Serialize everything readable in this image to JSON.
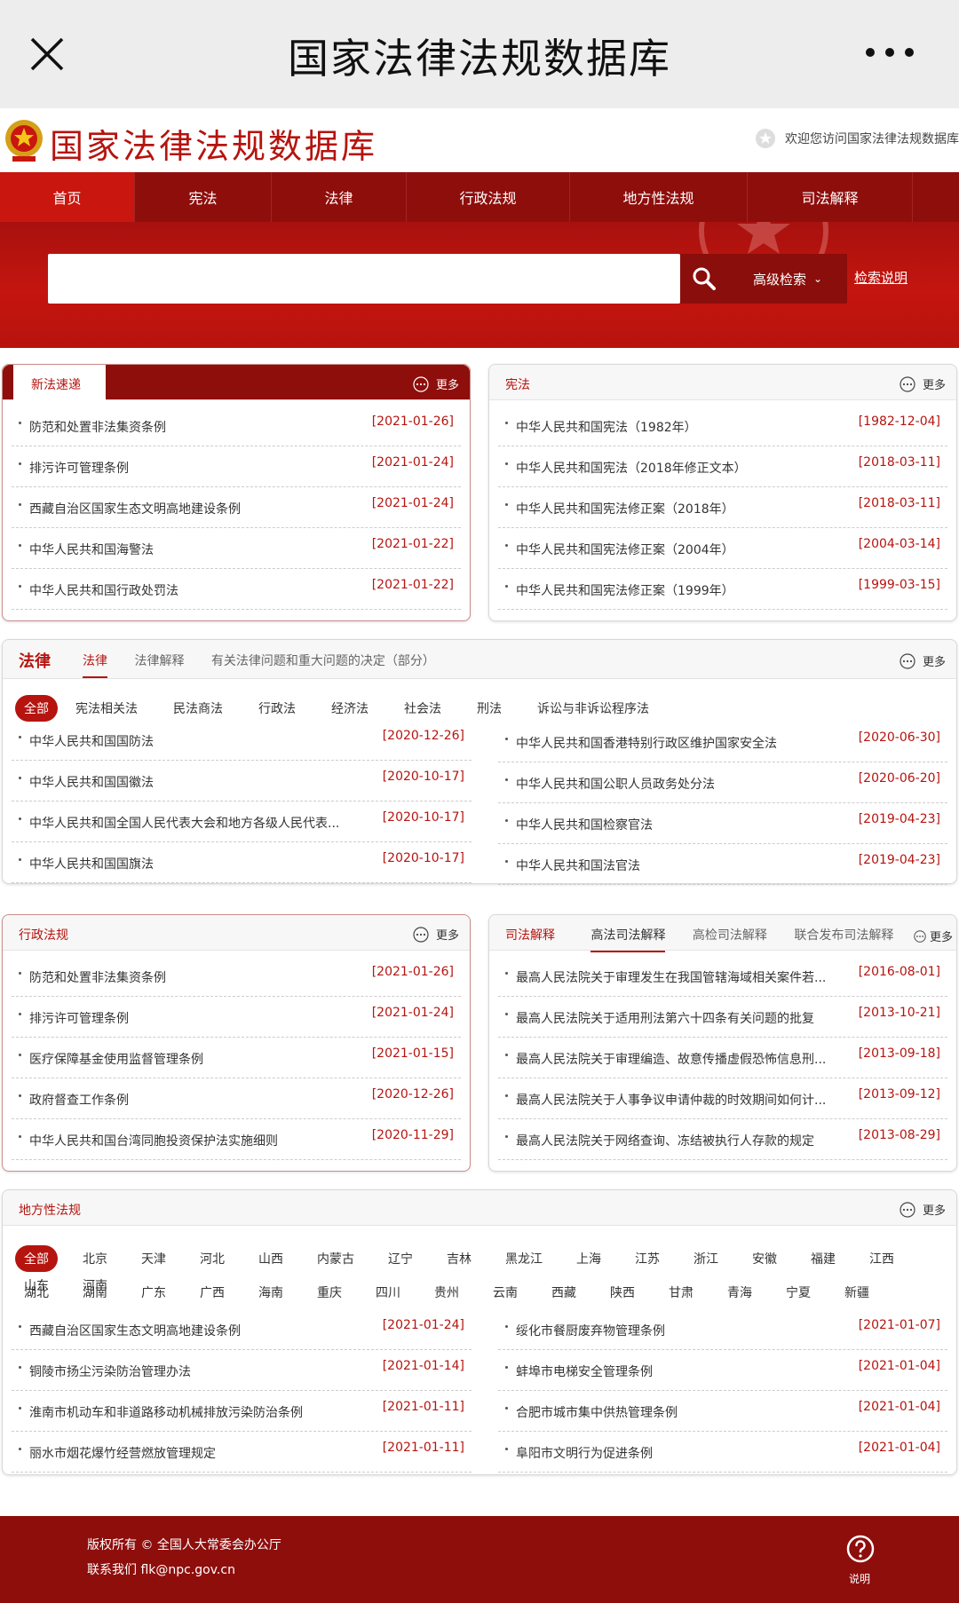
{
  "appbar": {
    "title": "国家法律法规数据库"
  },
  "header": {
    "site_title": "国家法律法规数据库",
    "welcome": "欢迎您访问国家法律法规数据库"
  },
  "nav": [
    "首页",
    "宪法",
    "法律",
    "行政法规",
    "地方性法规",
    "司法解释"
  ],
  "search": {
    "advanced": "高级检索",
    "help": "检索说明",
    "placeholder": ""
  },
  "new_laws": {
    "title": "新法速递",
    "more": "更多",
    "items": [
      {
        "name": "防范和处置非法集资条例",
        "date": "[2021-01-26]"
      },
      {
        "name": "排污许可管理条例",
        "date": "[2021-01-24]"
      },
      {
        "name": "西藏自治区国家生态文明高地建设条例",
        "date": "[2021-01-24]"
      },
      {
        "name": "中华人民共和国海警法",
        "date": "[2021-01-22]"
      },
      {
        "name": "中华人民共和国行政处罚法",
        "date": "[2021-01-22]"
      }
    ]
  },
  "constitution": {
    "title": "宪法",
    "more": "更多",
    "items": [
      {
        "name": "中华人民共和国宪法（1982年）",
        "date": "[1982-12-04]"
      },
      {
        "name": "中华人民共和国宪法（2018年修正文本）",
        "date": "[2018-03-11]"
      },
      {
        "name": "中华人民共和国宪法修正案（2018年）",
        "date": "[2018-03-11]"
      },
      {
        "name": "中华人民共和国宪法修正案（2004年）",
        "date": "[2004-03-14]"
      },
      {
        "name": "中华人民共和国宪法修正案（1999年）",
        "date": "[1999-03-15]"
      }
    ]
  },
  "laws": {
    "title": "法律",
    "more": "更多",
    "tabs": [
      "法律",
      "法律解释",
      "有关法律问题和重大问题的决定（部分）"
    ],
    "chips": [
      "全部",
      "宪法相关法",
      "民法商法",
      "行政法",
      "经济法",
      "社会法",
      "刑法",
      "诉讼与非诉讼程序法"
    ],
    "left": [
      {
        "name": "中华人民共和国国防法",
        "date": "[2020-12-26]"
      },
      {
        "name": "中华人民共和国国徽法",
        "date": "[2020-10-17]"
      },
      {
        "name": "中华人民共和国全国人民代表大会和地方各级人民代表...",
        "date": "[2020-10-17]"
      },
      {
        "name": "中华人民共和国国旗法",
        "date": "[2020-10-17]"
      }
    ],
    "right": [
      {
        "name": "中华人民共和国香港特别行政区维护国家安全法",
        "date": "[2020-06-30]"
      },
      {
        "name": "中华人民共和国公职人员政务处分法",
        "date": "[2020-06-20]"
      },
      {
        "name": "中华人民共和国检察官法",
        "date": "[2019-04-23]"
      },
      {
        "name": "中华人民共和国法官法",
        "date": "[2019-04-23]"
      }
    ]
  },
  "admin": {
    "title": "行政法规",
    "more": "更多",
    "items": [
      {
        "name": "防范和处置非法集资条例",
        "date": "[2021-01-26]"
      },
      {
        "name": "排污许可管理条例",
        "date": "[2021-01-24]"
      },
      {
        "name": "医疗保障基金使用监督管理条例",
        "date": "[2021-01-15]"
      },
      {
        "name": "政府督查工作条例",
        "date": "[2020-12-26]"
      },
      {
        "name": "中华人民共和国台湾同胞投资保护法实施细则",
        "date": "[2020-11-29]"
      }
    ]
  },
  "judicial": {
    "tabs": [
      "司法解释",
      "高法司法解释",
      "高检司法解释",
      "联合发布司法解释"
    ],
    "more": "更多",
    "items": [
      {
        "name": "最高人民法院关于审理发生在我国管辖海域相关案件若...",
        "date": "[2016-08-01]"
      },
      {
        "name": "最高人民法院关于适用刑法第六十四条有关问题的批复",
        "date": "[2013-10-21]"
      },
      {
        "name": "最高人民法院关于审理编造、故意传播虚假恐怖信息刑...",
        "date": "[2013-09-18]"
      },
      {
        "name": "最高人民法院关于人事争议申请仲裁的时效期间如何计...",
        "date": "[2013-09-12]"
      },
      {
        "name": "最高人民法院关于网络查询、冻结被执行人存款的规定",
        "date": "[2013-08-29]"
      }
    ]
  },
  "local": {
    "title": "地方性法规",
    "more": "更多",
    "chips_row1": [
      "全部",
      "北京",
      "天津",
      "河北",
      "山西",
      "内蒙古",
      "辽宁",
      "吉林",
      "黑龙江",
      "上海",
      "江苏",
      "浙江",
      "安徽",
      "福建",
      "江西",
      "山东",
      "河南"
    ],
    "chips_row2": [
      "湖北",
      "湖南",
      "广东",
      "广西",
      "海南",
      "重庆",
      "四川",
      "贵州",
      "云南",
      "西藏",
      "陕西",
      "甘肃",
      "青海",
      "宁夏",
      "新疆"
    ],
    "left": [
      {
        "name": "西藏自治区国家生态文明高地建设条例",
        "date": "[2021-01-24]"
      },
      {
        "name": "铜陵市扬尘污染防治管理办法",
        "date": "[2021-01-14]"
      },
      {
        "name": "淮南市机动车和非道路移动机械排放污染防治条例",
        "date": "[2021-01-11]"
      },
      {
        "name": "丽水市烟花爆竹经营燃放管理规定",
        "date": "[2021-01-11]"
      }
    ],
    "right": [
      {
        "name": "绥化市餐厨废弃物管理条例",
        "date": "[2021-01-07]"
      },
      {
        "name": "蚌埠市电梯安全管理条例",
        "date": "[2021-01-04]"
      },
      {
        "name": "合肥市城市集中供热管理条例",
        "date": "[2021-01-04]"
      },
      {
        "name": "阜阳市文明行为促进条例",
        "date": "[2021-01-04]"
      }
    ]
  },
  "footer": {
    "copyright": "版权所有 © 全国人大常委会办公厅",
    "contact": "联系我们 flk@npc.gov.cn",
    "help": "说明"
  }
}
